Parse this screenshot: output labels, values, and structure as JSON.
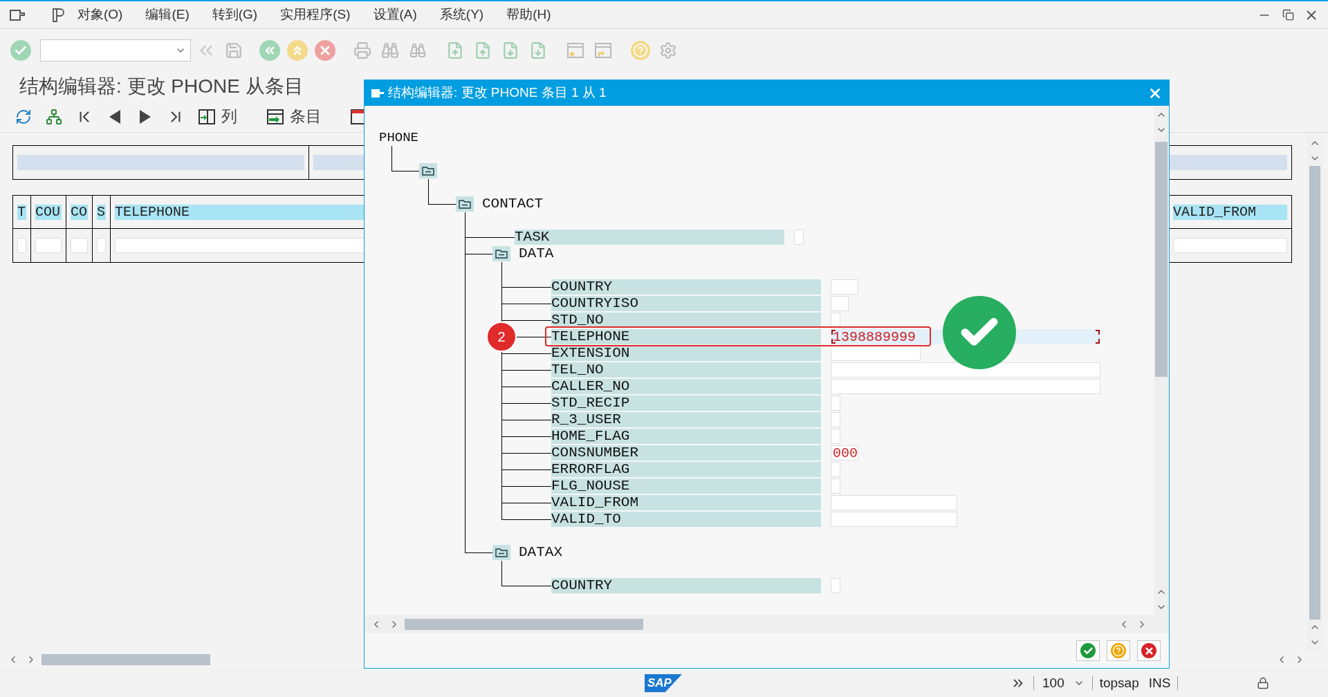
{
  "menu_bar": {
    "items": [
      "对象(O)",
      "编辑(E)",
      "转到(G)",
      "实用程序(S)",
      "设置(A)",
      "系统(Y)",
      "帮助(H)"
    ]
  },
  "page_title": "结构编辑器: 更改 PHONE 从条目",
  "app_toolbar": {
    "buttons": [
      {
        "kind": "columns",
        "label": "列"
      },
      {
        "kind": "entries",
        "label": "条目"
      }
    ]
  },
  "table": {
    "columns": [
      "T",
      "COU",
      "CO",
      "S",
      "TELEPHONE",
      "VALID_FROM"
    ]
  },
  "dialog": {
    "title": "结构编辑器: 更改 PHONE 条目 1 从 1",
    "tree": {
      "label": "PHONE",
      "children": [
        {
          "kind": "folder",
          "expanded": true,
          "children": [
            {
              "kind": "folder",
              "label": "CONTACT",
              "expanded": true,
              "children": [
                {
                  "kind": "flag",
                  "label": "TASK",
                  "focused": false
                },
                {
                  "kind": "folder",
                  "label": "DATA",
                  "expanded": true,
                  "children": [
                    {
                      "kind": "code",
                      "label": "COUNTRY",
                      "focused": false
                    },
                    {
                      "kind": "iso",
                      "label": "COUNTRYISO",
                      "focused": false
                    },
                    {
                      "kind": "flag",
                      "label": "STD_NO",
                      "focused": false
                    },
                    {
                      "kind": "text",
                      "label": "TELEPHONE",
                      "value": "1398889999",
                      "focused": true,
                      "callout": "2",
                      "confirmed": true
                    },
                    {
                      "kind": "extension",
                      "label": "EXTENSION",
                      "focused": false
                    },
                    {
                      "kind": "text",
                      "label": "TEL_NO",
                      "focused": false
                    },
                    {
                      "kind": "text",
                      "label": "CALLER_NO",
                      "focused": false
                    },
                    {
                      "kind": "flag",
                      "label": "STD_RECIP",
                      "focused": false
                    },
                    {
                      "kind": "flag",
                      "label": "R_3_USER",
                      "focused": false
                    },
                    {
                      "kind": "flag",
                      "label": "HOME_FLAG",
                      "focused": false
                    },
                    {
                      "kind": "code",
                      "label": "CONSNUMBER",
                      "value": "000",
                      "focused": false
                    },
                    {
                      "kind": "flag",
                      "label": "ERRORFLAG",
                      "focused": false
                    },
                    {
                      "kind": "flag",
                      "label": "FLG_NOUSE",
                      "focused": false
                    },
                    {
                      "kind": "date",
                      "label": "VALID_FROM",
                      "focused": false
                    },
                    {
                      "kind": "date",
                      "label": "VALID_TO",
                      "focused": false
                    }
                  ]
                },
                {
                  "kind": "folder",
                  "label": "DATAX",
                  "expanded": true,
                  "children": [
                    {
                      "kind": "flag",
                      "label": "COUNTRY",
                      "focused": false
                    }
                  ]
                }
              ]
            }
          ]
        }
      ]
    }
  },
  "status_bar": {
    "logo": "SAP",
    "zoom": "100",
    "system": "topsap",
    "mode": "INS"
  }
}
